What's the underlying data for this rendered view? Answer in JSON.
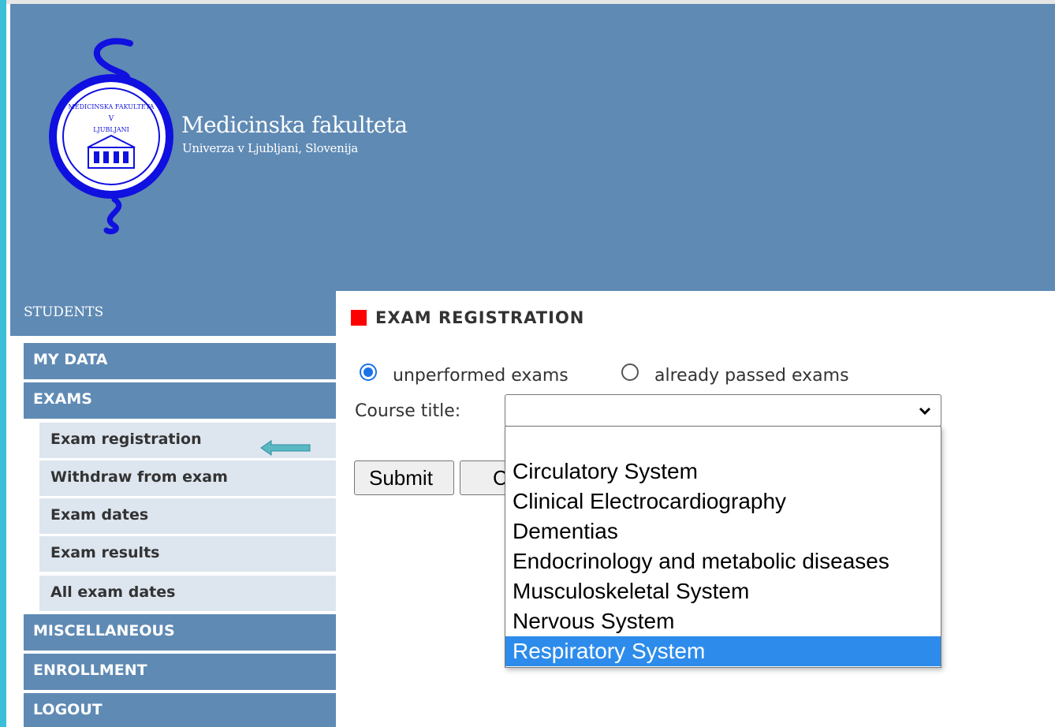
{
  "header": {
    "brand_name": "Medicinska fakulteta",
    "brand_subtitle": "Univerza v Ljubljani, Slovenija",
    "logo_text_top": "MEDICINSKA FAKULTETA",
    "logo_text_v": "V",
    "logo_text_city": "LJUBLJANI"
  },
  "sidebar": {
    "heading": "STUDENTS",
    "items": [
      {
        "label": "MY DATA"
      },
      {
        "label": "EXAMS"
      },
      {
        "label": "Exam registration"
      },
      {
        "label": "Withdraw from exam"
      },
      {
        "label": "Exam dates"
      },
      {
        "label": "Exam results"
      },
      {
        "label": "All exam dates"
      },
      {
        "label": "MISCELLANEOUS"
      },
      {
        "label": "ENROLLMENT"
      },
      {
        "label": "LOGOUT"
      }
    ]
  },
  "main": {
    "title": "EXAM REGISTRATION",
    "radio_unperformed": "unperformed exams",
    "radio_passed": "already passed exams",
    "selected_filter": "unperformed exams",
    "course_label": "Course title:",
    "course_value": "",
    "submit_label": "Submit",
    "second_button_label": "C"
  },
  "dropdown": {
    "options": [
      "",
      "Circulatory System",
      "Clinical Electrocardiography",
      "Dementias",
      "Endocrinology and metabolic diseases",
      "Musculoskeletal System",
      "Nervous System",
      "Respiratory System"
    ],
    "highlighted": "Respiratory System"
  },
  "colors": {
    "header_bg": "#5f8ab4",
    "left_accent": "#3bbfd8",
    "submenu_bg": "#dde5ef",
    "title_marker": "#ff0000",
    "highlight": "#2d8ceb",
    "arrow": "#5ab8c4"
  },
  "icons": [
    "logo-seal-icon",
    "arrow-left-icon",
    "chevron-down-icon"
  ]
}
